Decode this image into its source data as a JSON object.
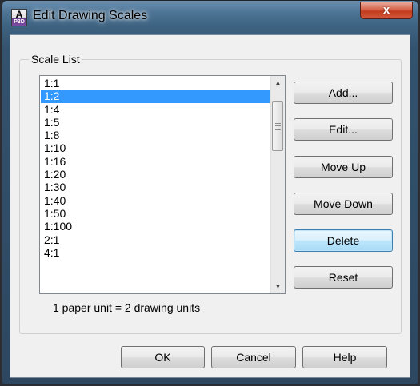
{
  "window": {
    "title": "Edit Drawing Scales",
    "app_icon_letter": "A",
    "app_icon_sub": "P3D",
    "close_glyph": "x"
  },
  "groupbox": {
    "label": "Scale List"
  },
  "scale_list": {
    "items": [
      "1:1",
      "1:2",
      "1:4",
      "1:5",
      "1:8",
      "1:10",
      "1:16",
      "1:20",
      "1:30",
      "1:40",
      "1:50",
      "1:100",
      "2:1",
      "4:1"
    ],
    "selected_index": 1
  },
  "scrollbar": {
    "up_glyph": "▲",
    "down_glyph": "▼"
  },
  "status": {
    "text": "1 paper unit = 2 drawing units"
  },
  "side_buttons": {
    "add": "Add...",
    "edit": "Edit...",
    "move_up": "Move Up",
    "move_down": "Move Down",
    "delete": "Delete",
    "reset": "Reset"
  },
  "footer_buttons": {
    "ok": "OK",
    "cancel": "Cancel",
    "help": "Help"
  },
  "colors": {
    "selection": "#3399ff",
    "close_button": "#c23b1e",
    "dialog_background": "#f0f0f0"
  }
}
